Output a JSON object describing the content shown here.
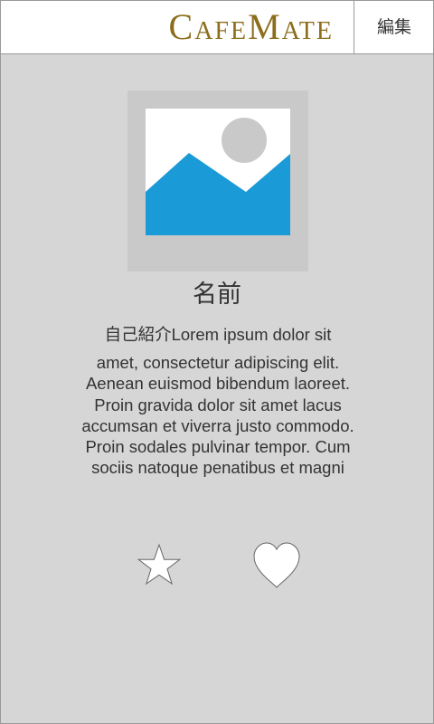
{
  "header": {
    "app_title": "CafeMate",
    "edit_label": "編集"
  },
  "profile": {
    "name": "名前",
    "bio_line1": "自己紹介Lorem ipsum dolor sit",
    "bio_rest": "amet, consectetur adipiscing elit. Aenean euismod bibendum laoreet. Proin gravida dolor sit amet lacus accumsan et viverra justo commodo. Proin sodales pulvinar tempor. Cum sociis natoque penatibus et magni"
  },
  "actions": {
    "star_icon": "star-outline-icon",
    "heart_icon": "heart-outline-icon"
  },
  "colors": {
    "brand": "#8c6d1b",
    "background": "#d6d6d6",
    "image_placeholder_blue": "#1a9ad6",
    "image_placeholder_gray": "#c9c9c9"
  }
}
